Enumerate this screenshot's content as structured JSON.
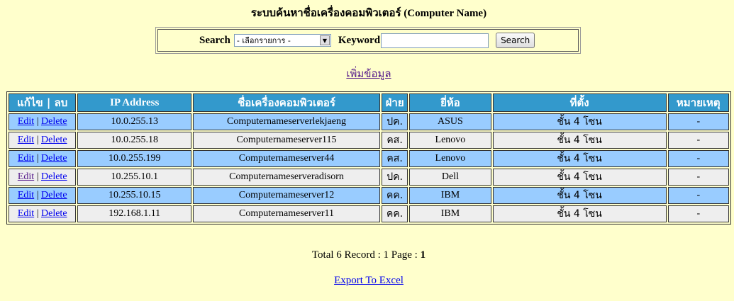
{
  "title": "ระบบค้นหาชื่อเครื่องคอมพิวเตอร์ (Computer Name)",
  "search": {
    "label": "Search",
    "select_value": "- เลือกรายการ -",
    "keyword_label": "Keyword",
    "keyword_value": "",
    "button_label": "Search"
  },
  "add_link": "เพิ่มข้อมูล",
  "table": {
    "headers": [
      "แก้ไข | ลบ",
      "IP Address",
      "ชื่อเครื่องคอมพิวเตอร์",
      "ฝ่าย",
      "ยี่ห้อ",
      "ที่ตั้ง",
      "หมายเหตุ"
    ],
    "edit_label": "Edit",
    "separator": "|",
    "delete_label": "Delete",
    "rows": [
      {
        "ip": "10.0.255.13",
        "name": "Computernameserverlekjaeng",
        "dept": "ปค.",
        "brand": "ASUS",
        "location": "ชั้น 4 โซน",
        "note": "-"
      },
      {
        "ip": "10.0.255.18",
        "name": "Computernameserver115",
        "dept": "คส.",
        "brand": "Lenovo",
        "location": "ชั้น 4 โซน",
        "note": "-"
      },
      {
        "ip": "10.0.255.199",
        "name": "Computernameserver44",
        "dept": "คส.",
        "brand": "Lenovo",
        "location": "ชั้น 4 โซน",
        "note": "-"
      },
      {
        "ip": "10.255.10.1",
        "name": "Computernameserveradisorn",
        "dept": "ปค.",
        "brand": "Dell",
        "location": "ชั้น 4 โซน",
        "note": "-"
      },
      {
        "ip": "10.255.10.15",
        "name": "Computernameserver12",
        "dept": "คค.",
        "brand": "IBM",
        "location": "ชั้น 4 โซน",
        "note": "-"
      },
      {
        "ip": "192.168.1.11",
        "name": "Computernameserver11",
        "dept": "คค.",
        "brand": "IBM",
        "location": "ชั้น 4 โซน",
        "note": "-"
      }
    ]
  },
  "footer": {
    "total_text": "Total 6 Record : 1 Page : ",
    "current_page": "1",
    "export_label": "Export To Excel"
  },
  "colors": {
    "background": "#ffffcc",
    "header": "#3399cc",
    "row_odd": "#99ccff",
    "row_even": "#eeeeee"
  }
}
